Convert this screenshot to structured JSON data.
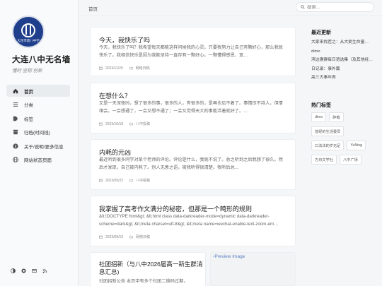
{
  "site": {
    "logo_text": "大连市第八中学",
    "title": "大连八中无名墙",
    "subtitle": "懂时 坚韧 创新"
  },
  "nav": [
    {
      "label": "首页",
      "icon": "home-icon",
      "active": true
    },
    {
      "label": "分类",
      "icon": "list-icon"
    },
    {
      "label": "标签",
      "icon": "tag-icon"
    },
    {
      "label": "归档(时间线)",
      "icon": "archive-icon"
    },
    {
      "label": "关于/说明/更多信息",
      "icon": "info-icon"
    },
    {
      "label": "网站状态页面",
      "icon": "globe-icon"
    }
  ],
  "breadcrumb": "首页",
  "search": {
    "placeholder": "搜索..."
  },
  "posts": [
    {
      "title": "今天，我快乐了吗",
      "excerpt": "今天，我快乐了吗？我希望每天都能这样问候我的心灵。只要我努力让自己有颗好心，那么我就快乐了。我相信快乐是因为我能坚持一直存有一颗好心。一颗懂得感恩、宽…",
      "date": "2023/11/29",
      "category": "网络日稿"
    },
    {
      "title": "在想什么？",
      "excerpt": "又是一天深夜时，想了很多的事，很多的人，有很多的，是再也见不着了。事情压不持人，但情绪会。一会想通了，一会又想不通了；一会又觉得天大的事能活着就好了。…",
      "date": "2023/10/18",
      "category": "八中投稿"
    },
    {
      "title": "内耗的元凶",
      "excerpt": "最近听到很多同学对某个老师的评论。评论是什么，我就不说了。总之听到之后我想了很久。然后才发现，自己被内耗了。别人无意之语，被我听得很清楚。我听后总…",
      "date": "2023/09/22",
      "category": "八中投稿"
    },
    {
      "title": "我掌握了高考作文满分的秘密，但那是一个畸形的规则",
      "excerpt": "&lt;!DOCTYPE html&gt; &lt;html class data-darkreader-mode=dynamic data-darkreader-scheme=dark&gt; &lt;meta charset=utf-8&gt; &lt;meta name=wechat-enable-text-zoom-em…",
      "date": "2023/09/19",
      "category": "网络日稿"
    },
    {
      "title": "社团招新（与八中2026届高一新生群消息汇总)",
      "excerpt": "社团招新公告 本页中有多个社团二维码过期，",
      "thumb_alt": "Preview Image"
    }
  ],
  "recent": {
    "title": "最近更新",
    "items": [
      "大家来找茬之：从大爱生命量…",
      "dimo",
      "滨边寝寝每日语选集（及其他经典…",
      "日记录：事外篇",
      "高三大事年表"
    ]
  },
  "tags": {
    "title": "热门标签",
    "items": [
      "dimo",
      "碎载",
      "曾经的生活委员",
      "口法法的岁无足",
      "YuNing",
      "方舟文学社",
      "八中广场"
    ]
  }
}
